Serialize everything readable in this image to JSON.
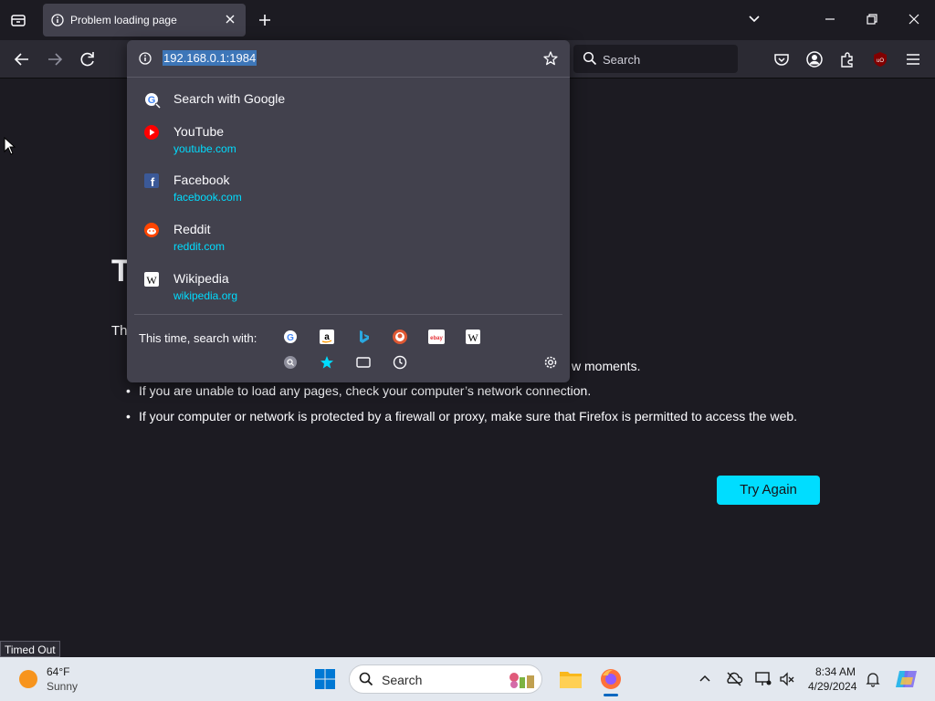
{
  "tabs": [
    {
      "title": "Problem loading page"
    }
  ],
  "navbar": {
    "search_placeholder": "Search"
  },
  "urlbar": {
    "value": "192.168.0.1:1984"
  },
  "dropdown": {
    "search_with": "Search with Google",
    "results": [
      {
        "title": "YouTube",
        "url": "youtube.com",
        "icon": "youtube-icon",
        "color": "#ff0000"
      },
      {
        "title": "Facebook",
        "url": "facebook.com",
        "icon": "facebook-icon",
        "color": "#1877f2"
      },
      {
        "title": "Reddit",
        "url": "reddit.com",
        "icon": "reddit-icon",
        "color": "#ff4500"
      },
      {
        "title": "Wikipedia",
        "url": "wikipedia.org",
        "icon": "wikipedia-icon",
        "color": "#ffffff"
      }
    ],
    "this_time_label": "This time, search with:",
    "engines": [
      "google",
      "amazon",
      "bing",
      "duckduckgo",
      "ebay",
      "wikipedia"
    ]
  },
  "error_page": {
    "title_visible": "T",
    "lead_visible": "Th",
    "bullets": [
      "w moments.",
      "If you are unable to load any pages, check your computer’s network connection.",
      "If your computer or network is protected by a firewall or proxy, make sure that Firefox is permitted to access the web."
    ],
    "try_again": "Try Again"
  },
  "status_text": "Timed Out",
  "taskbar": {
    "weather_temp": "64°F",
    "weather_desc": "Sunny",
    "search_placeholder": "Search",
    "time": "8:34 AM",
    "date": "4/29/2024"
  },
  "colors": {
    "accent": "#00ddff",
    "panel": "#42414d",
    "page_bg": "#1c1b22"
  }
}
